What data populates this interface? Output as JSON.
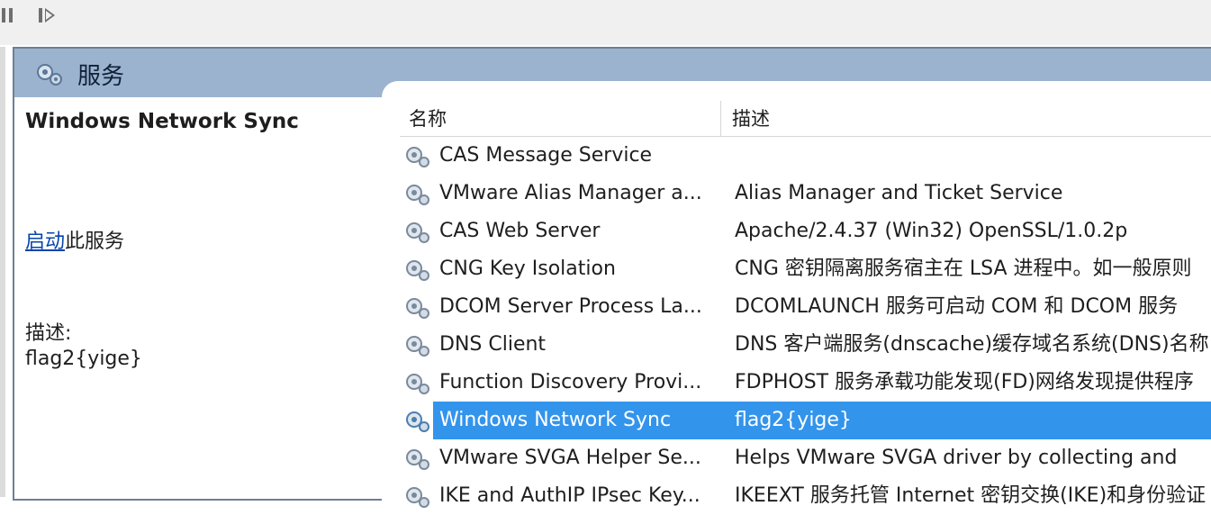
{
  "window": {
    "header_title": "服务"
  },
  "left_pane": {
    "service_name": "Windows Network Sync",
    "action_link": "启动",
    "action_suffix": "此服务",
    "desc_label": "描述:",
    "desc_value": "flag2{yige}"
  },
  "list": {
    "columns": [
      "名称",
      "描述"
    ],
    "rows": [
      {
        "name": "CAS Message Service",
        "desc": ""
      },
      {
        "name": "VMware Alias Manager a...",
        "desc": "Alias Manager and Ticket Service"
      },
      {
        "name": "CAS Web Server",
        "desc": "Apache/2.4.37 (Win32) OpenSSL/1.0.2p"
      },
      {
        "name": "CNG Key Isolation",
        "desc": "CNG 密钥隔离服务宿主在 LSA 进程中。如一般原则"
      },
      {
        "name": "DCOM Server Process La...",
        "desc": "DCOMLAUNCH 服务可启动 COM 和 DCOM 服务"
      },
      {
        "name": "DNS Client",
        "desc": "DNS 客户端服务(dnscache)缓存域名系统(DNS)名称"
      },
      {
        "name": "Function Discovery Provi...",
        "desc": "FDPHOST 服务承载功能发现(FD)网络发现提供程序"
      },
      {
        "name": "Windows Network Sync",
        "desc": "flag2{yige}",
        "selected": true
      },
      {
        "name": "VMware SVGA Helper Se...",
        "desc": "Helps VMware SVGA driver by collecting and"
      },
      {
        "name": "IKE and AuthIP IPsec Key...",
        "desc": "IKEEXT 服务托管 Internet 密钥交换(IKE)和身份验证"
      }
    ]
  },
  "colors": {
    "header_band": "#9bb3cf",
    "selection": "#3394ec",
    "link": "#0645ad"
  }
}
